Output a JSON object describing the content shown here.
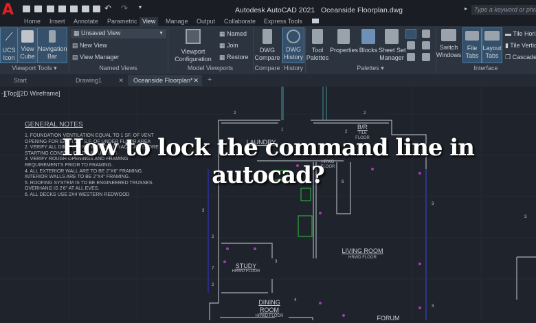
{
  "titlebar": {
    "app_title": "Autodesk AutoCAD 2021",
    "file_name": "Oceanside Floorplan.dwg",
    "search_placeholder": "Type a keyword or phrase",
    "logo": "A"
  },
  "ribbon_tabs": [
    "Home",
    "Insert",
    "Annotate",
    "Parametric",
    "View",
    "Manage",
    "Output",
    "Collaborate",
    "Express Tools"
  ],
  "active_tab": "View",
  "ribbon": {
    "viewport_tools": {
      "label": "Viewport Tools",
      "buttons": [
        [
          "UCS",
          "Icon"
        ],
        [
          "View",
          "Cube"
        ],
        [
          "Navigation",
          "Bar"
        ]
      ]
    },
    "named_views": {
      "label": "Named Views",
      "dropdown": "Unsaved View",
      "items": [
        "New View",
        "View Manager"
      ]
    },
    "model_viewports": {
      "label": "Model Viewports",
      "config": [
        "Viewport",
        "Configuration"
      ],
      "items": [
        "Named",
        "Join",
        "Restore"
      ]
    },
    "compare": {
      "label": "Compare",
      "button": [
        "DWG",
        "Compare"
      ]
    },
    "history": {
      "label": "History",
      "button": [
        "DWG",
        "History"
      ]
    },
    "palettes": {
      "label": "Palettes",
      "buttons": [
        [
          "Tool",
          "Palettes"
        ],
        [
          "Properties",
          ""
        ],
        [
          "Blocks",
          ""
        ],
        [
          "Sheet Set",
          "Manager"
        ]
      ]
    },
    "interface": {
      "label": "Interface",
      "buttons": [
        [
          "Switch",
          "Windows"
        ],
        [
          "File",
          "Tabs"
        ],
        [
          "Layout",
          "Tabs"
        ]
      ],
      "items": [
        "Tile Horizontally",
        "Tile Vertically",
        "Cascade"
      ]
    }
  },
  "doc_tabs": [
    {
      "label": "Start"
    },
    {
      "label": "Drawing1"
    },
    {
      "label": "Oceanside Floorplan*"
    }
  ],
  "viewport_label": "-][Top][2D Wireframe]",
  "notes": {
    "title": "GENERAL NOTES",
    "items": [
      "1.  FOUNDATION VENTILATION EQUAL TO 1 SF. OF VENT",
      "     OPENING FOR EACH 150 S.F. OF UNDER FLOOR AREA",
      "2.  VERIFY ALL DIMENSIONS WITH CONTRACTOR BEFORE",
      "     STARTING CONSTRUCTION & BUILDING",
      "3.  VERIFY ROUGH OPENINGS AND FRAMING",
      "     REQUIREMENTS PRIOR TO FRAMING.",
      "4.  ALL EXTERIOR WALL ARE TO BE 2\"X6\" FRAMING.",
      "     INTERIOR WALLS ARE TO BE 2\"X4\" FRAMING.",
      "5.  ROOFING SYSTEM IS TO BE ENGINEERED TRUSSES.",
      "     OVERHANG IS 2'6\" AT ALL EVES.",
      "6.  ALL DECKS USE 2X4 WESTERN REDWOOD"
    ]
  },
  "rooms": {
    "laundry": "LAUNDRY",
    "br": "B/R",
    "br_floor1": "TILE",
    "br_floor2": "FLOOR",
    "hrwd": "HRWD",
    "hrwd_floor": "FLOOR",
    "living": "LIVING ROOM",
    "living_floor": "HRWD FLOOR",
    "study": "STUDY",
    "study_floor": "HRWD FLOOR",
    "dining1": "DINING",
    "dining2": "ROOM",
    "dining_floor": "HRWD FLOOR",
    "forum": "FORUM"
  },
  "dims": [
    "2",
    "2",
    "2",
    "1",
    "2",
    "3",
    "3",
    "2",
    "7",
    "2",
    "3",
    "4",
    "3",
    "6",
    "3"
  ],
  "headline": [
    "How to lock the command line in",
    "autocad?"
  ]
}
